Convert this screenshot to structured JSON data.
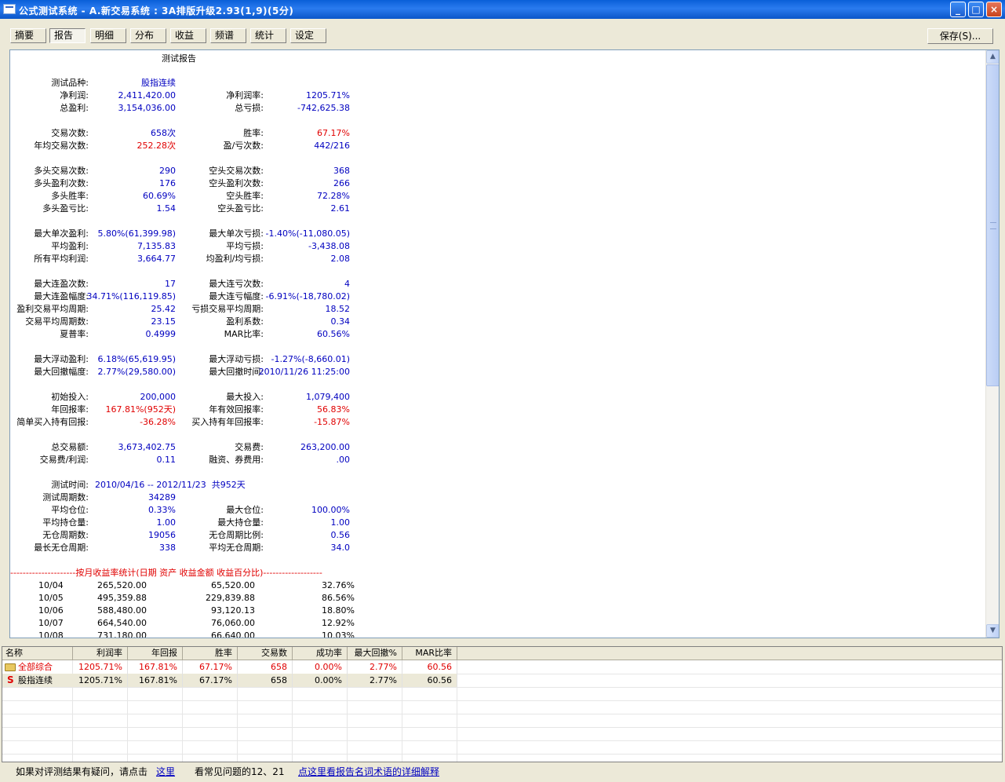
{
  "window": {
    "title": "公式测试系统 - A.新交易系统 : 3A排版升级2.93(1,9)(5分)",
    "min": "_",
    "max": "□",
    "close": "×"
  },
  "tabs": [
    "摘要",
    "报告",
    "明细",
    "分布",
    "收益",
    "频谱",
    "统计",
    "设定"
  ],
  "save_label": "保存(S)...",
  "report": {
    "title": "测试报告",
    "rows": [
      {
        "l1": "测试品种:",
        "v1": "股指连续",
        "l2": "",
        "v2": ""
      },
      {
        "l1": "净利润:",
        "v1": "2,411,420.00",
        "l2": "净利润率:",
        "v2": "1205.71%"
      },
      {
        "l1": "总盈利:",
        "v1": "3,154,036.00",
        "l2": "总亏损:",
        "v2": "-742,625.38"
      },
      {
        "l1": "交易次数:",
        "v1": "658次",
        "l2": "胜率:",
        "v2": "67.17%"
      },
      {
        "l1": "年均交易次数:",
        "v1": "252.28次",
        "l2": "盈/亏次数:",
        "v2": "442/216"
      },
      {
        "l1": "多头交易次数:",
        "v1": "290",
        "l2": "空头交易次数:",
        "v2": "368"
      },
      {
        "l1": "多头盈利次数:",
        "v1": "176",
        "l2": "空头盈利次数:",
        "v2": "266"
      },
      {
        "l1": "多头胜率:",
        "v1": "60.69%",
        "l2": "空头胜率:",
        "v2": "72.28%"
      },
      {
        "l1": "多头盈亏比:",
        "v1": "1.54",
        "l2": "空头盈亏比:",
        "v2": "2.61"
      },
      {
        "l1": "最大单次盈利:",
        "v1": "5.80%(61,399.98)",
        "l2": "最大单次亏损:",
        "v2": "-1.40%(-11,080.05)"
      },
      {
        "l1": "平均盈利:",
        "v1": "7,135.83",
        "l2": "平均亏损:",
        "v2": "-3,438.08"
      },
      {
        "l1": "所有平均利润:",
        "v1": "3,664.77",
        "l2": "均盈利/均亏损:",
        "v2": "2.08"
      },
      {
        "l1": "最大连盈次数:",
        "v1": "17",
        "l2": "最大连亏次数:",
        "v2": "4"
      },
      {
        "l1": "最大连盈幅度:",
        "v1": "34.71%(116,119.85)",
        "l2": "最大连亏幅度:",
        "v2": "-6.91%(-18,780.02)"
      },
      {
        "l1": "盈利交易平均周期:",
        "v1": "25.42",
        "l2": "亏损交易平均周期:",
        "v2": "18.52"
      },
      {
        "l1": "交易平均周期数:",
        "v1": "23.15",
        "l2": "盈利系数:",
        "v2": "0.34"
      },
      {
        "l1": "夏普率:",
        "v1": "0.4999",
        "l2": "MAR比率:",
        "v2": "60.56%"
      },
      {
        "l1": "最大浮动盈利:",
        "v1": "6.18%(65,619.95)",
        "l2": "最大浮动亏损:",
        "v2": "-1.27%(-8,660.01)"
      },
      {
        "l1": "最大回撤幅度:",
        "v1": "2.77%(29,580.00)",
        "l2": "最大回撤时间:",
        "v2": "2010/11/26 11:25:00"
      },
      {
        "l1": "初始投入:",
        "v1": "200,000",
        "l2": "最大投入:",
        "v2": "1,079,400"
      },
      {
        "l1": "年回报率:",
        "v1": "167.81%(952天)",
        "l2": "年有效回报率:",
        "v2": "56.83%"
      },
      {
        "l1": "简单买入持有回报:",
        "v1": "-36.28%",
        "l2": "买入持有年回报率:",
        "v2": "-15.87%"
      },
      {
        "l1": "总交易额:",
        "v1": "3,673,402.75",
        "l2": "交易费:",
        "v2": "263,200.00"
      },
      {
        "l1": "交易费/利润:",
        "v1": "0.11",
        "l2": "融资、券费用:",
        "v2": ".00"
      },
      {
        "l1": "测试时间:",
        "v1": "2010/04/16 -- 2012/11/23  共952天",
        "l2": "",
        "v2": ""
      },
      {
        "l1": "测试周期数:",
        "v1": "34289",
        "l2": "",
        "v2": ""
      },
      {
        "l1": "平均仓位:",
        "v1": "0.33%",
        "l2": "最大仓位:",
        "v2": "100.00%"
      },
      {
        "l1": "平均持仓量:",
        "v1": "1.00",
        "l2": "最大持仓量:",
        "v2": "1.00"
      },
      {
        "l1": "无仓周期数:",
        "v1": "19056",
        "l2": "无仓周期比例:",
        "v2": "0.56"
      },
      {
        "l1": "最长无仓周期:",
        "v1": "338",
        "l2": "平均无仓周期:",
        "v2": "34.0"
      }
    ],
    "monthly_header": "---------------------按月收益率统计(日期 资产 收益金额 收益百分比)-------------------",
    "monthly": [
      {
        "m": "10/04",
        "asset": "265,520.00",
        "gain": "65,520.00",
        "pct": "32.76%"
      },
      {
        "m": "10/05",
        "asset": "495,359.88",
        "gain": "229,839.88",
        "pct": "86.56%"
      },
      {
        "m": "10/06",
        "asset": "588,480.00",
        "gain": "93,120.13",
        "pct": "18.80%"
      },
      {
        "m": "10/07",
        "asset": "664,540.00",
        "gain": "76,060.00",
        "pct": "12.92%"
      },
      {
        "m": "10/08",
        "asset": "731,180.00",
        "gain": "66,640.00",
        "pct": "10.03%"
      }
    ]
  },
  "grid": {
    "headers": [
      "名称",
      "利润率",
      "年回报",
      "胜率",
      "交易数",
      "成功率",
      "最大回撤%",
      "MAR比率"
    ],
    "rows": [
      {
        "name": "全部综合",
        "cells": [
          "1205.71%",
          "167.81%",
          "67.17%",
          "658",
          "0.00%",
          "2.77%",
          "60.56"
        ]
      },
      {
        "name": "股指连续",
        "cells": [
          "1205.71%",
          "167.81%",
          "67.17%",
          "658",
          "0.00%",
          "2.77%",
          "60.56"
        ]
      }
    ]
  },
  "footer": {
    "t1": "如果对评测结果有疑问，请点击",
    "link1": "这里",
    "t2": "看常见问题的12、21",
    "link2": "点这里看报告名词术语的详细解释"
  },
  "colors": {
    "value_blue": "#0000C0",
    "negative_red": "#E00000",
    "title_bar": "#0A5FD8"
  }
}
